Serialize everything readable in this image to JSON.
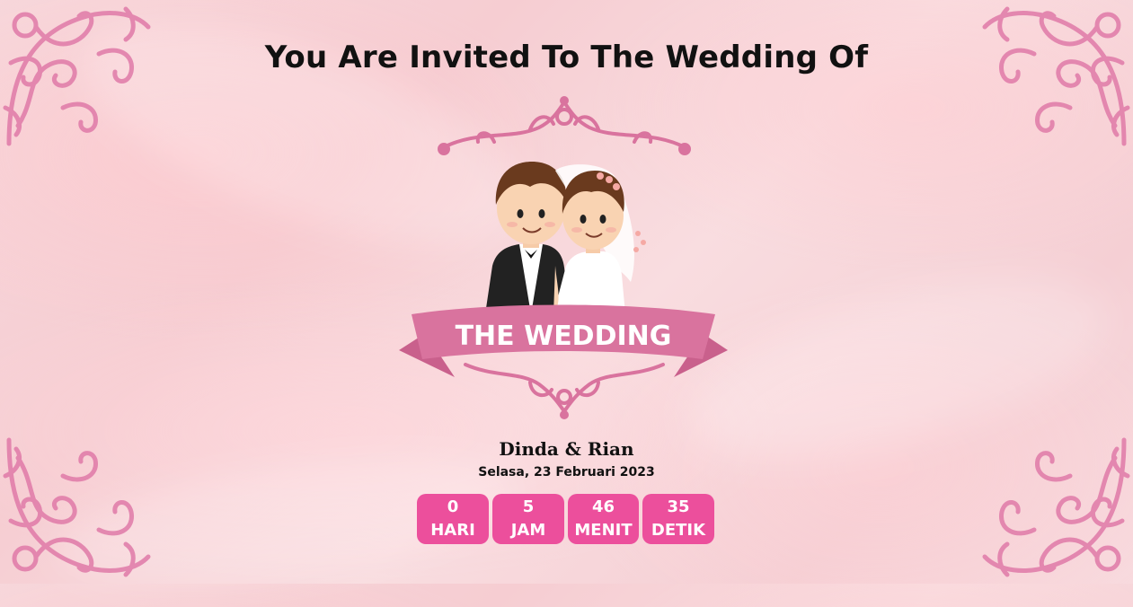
{
  "header": {
    "title": "You Are Invited To The Wedding Of"
  },
  "banner": {
    "text": "THE WEDDING"
  },
  "couple": {
    "names": "Dinda & Rian"
  },
  "event": {
    "date": "Selasa, 23 Februari 2023"
  },
  "countdown": [
    {
      "value": "0",
      "unit": "HARI"
    },
    {
      "value": "5",
      "unit": "JAM"
    },
    {
      "value": "46",
      "unit": "MENIT"
    },
    {
      "value": "35",
      "unit": "DETIK"
    }
  ],
  "colors": {
    "accent": "#ec4f9c",
    "ornament": "#e07aa8",
    "banner": "#d9739e"
  },
  "icons": {
    "corner": "floral-corner-ornament-icon"
  }
}
